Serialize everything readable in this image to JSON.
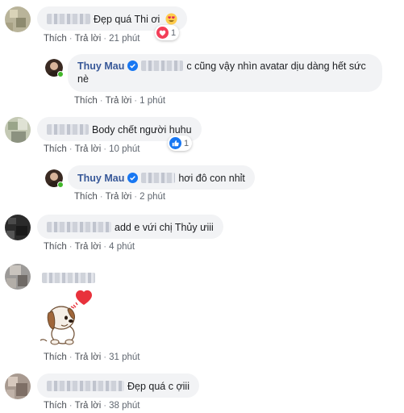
{
  "comments": [
    {
      "text": "Đẹp quá Thi ơi",
      "time": "21 phút",
      "reaction_count": "1",
      "reaction_type": "love"
    },
    {
      "author": "Thuy Mau",
      "text": "c cũng vậy nhìn avatar dịu dàng hết sức nè",
      "line1": "c cũng vậy nhìn avatar dịu dàng hết sức",
      "line2": "nè",
      "time": "1 phút"
    },
    {
      "text": "Body chết người huhu",
      "time": "10 phút",
      "reaction_count": "1",
      "reaction_type": "like"
    },
    {
      "author": "Thuy Mau",
      "text": "hơi đô con nhỉt",
      "time": "2 phút"
    },
    {
      "text": "add e vứi chị Thủy ưiii",
      "time": "4 phút"
    },
    {
      "sticker": "puppy-heart-sticker",
      "time": "31 phút"
    },
    {
      "text": "Đẹp quá c ợiii",
      "time": "38 phút"
    }
  ],
  "actions": {
    "like": "Thích",
    "reply": "Trả lời",
    "separator": "·"
  },
  "colors": {
    "name": "#385898",
    "bubble": "#f2f3f5",
    "like_blue": "#1877f2",
    "love_red": "#f33e58",
    "online": "#42b72a"
  }
}
